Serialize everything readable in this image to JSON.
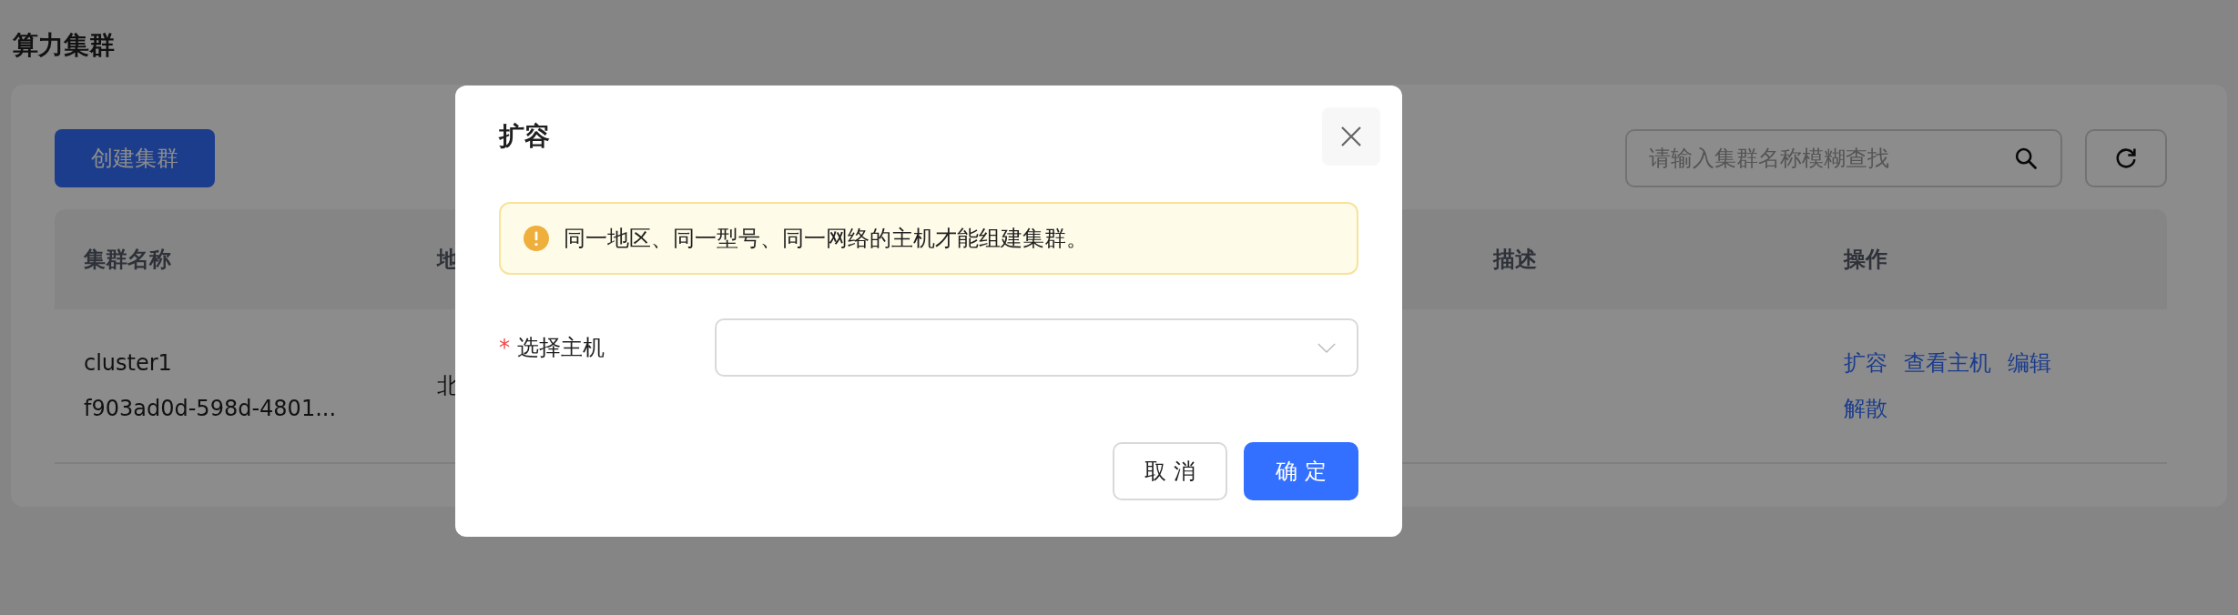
{
  "page": {
    "title": "算力集群"
  },
  "toolbar": {
    "create_button": "创建集群",
    "search": {
      "placeholder": "请输入集群名称模糊查找"
    }
  },
  "table": {
    "columns": [
      "集群名称",
      "地",
      "描述",
      "操作"
    ],
    "rows": [
      {
        "name": "cluster1",
        "id": "f903ad0d-598d-4801...",
        "region": "北",
        "description": "",
        "actions": [
          "扩容",
          "查看主机",
          "编辑",
          "解散"
        ]
      }
    ]
  },
  "dialog": {
    "title": "扩容",
    "alert": {
      "text": "同一地区、同一型号、同一网络的主机才能组建集群。"
    },
    "field": {
      "required_mark": "*",
      "label": "选择主机"
    },
    "buttons": [
      {
        "label": "取 消",
        "kind": "secondary"
      },
      {
        "label": "确 定",
        "kind": "primary"
      }
    ]
  }
}
